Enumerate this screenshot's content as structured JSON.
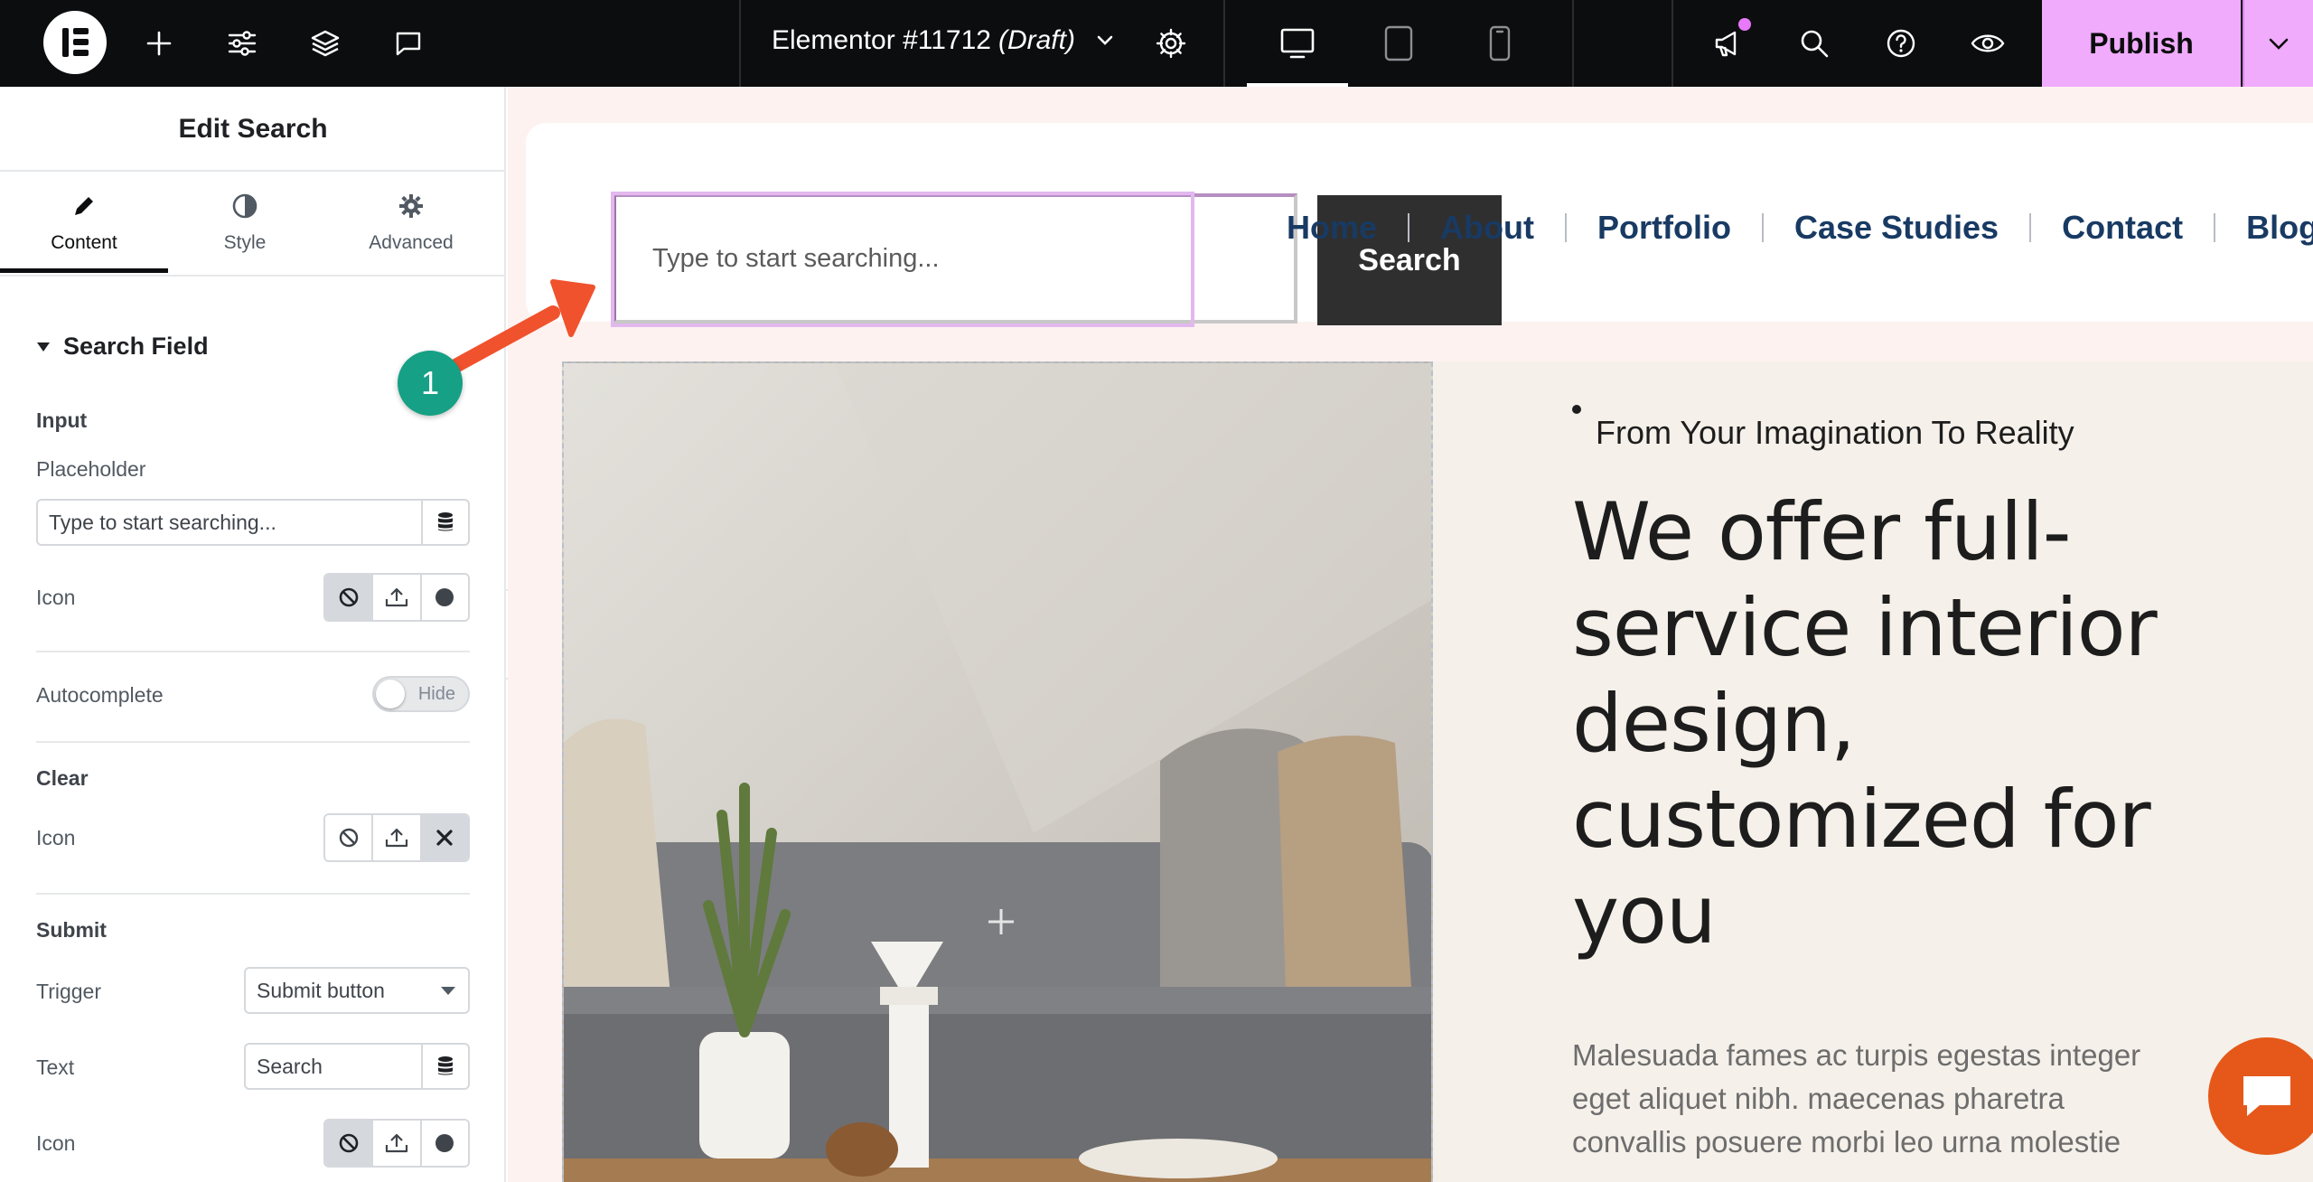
{
  "topbar": {
    "document_name": "Elementor #11712",
    "document_status": "(Draft)",
    "publish_label": "Publish",
    "accent_color": "#f0abfc"
  },
  "panel": {
    "title": "Edit Search",
    "tabs": [
      {
        "label": "Content",
        "icon": "pencil-icon"
      },
      {
        "label": "Style",
        "icon": "contrast-icon"
      },
      {
        "label": "Advanced",
        "icon": "gear-icon"
      }
    ],
    "section_title": "Search Field",
    "input_heading": "Input",
    "placeholder_label": "Placeholder",
    "placeholder_value": "Type to start searching...",
    "icon_label": "Icon",
    "autocomplete_label": "Autocomplete",
    "autocomplete_state": "Hide",
    "clear_heading": "Clear",
    "clear_icon_label": "Icon",
    "submit_heading": "Submit",
    "trigger_label": "Trigger",
    "trigger_value": "Submit button",
    "text_label": "Text",
    "text_value": "Search",
    "submit_icon_label": "Icon"
  },
  "canvas": {
    "search_placeholder": "Type to start searching...",
    "search_button": "Search",
    "nav": [
      "Home",
      "About",
      "Portfolio",
      "Case Studies",
      "Contact",
      "Blog"
    ],
    "tagline": "From Your Imagination To Reality",
    "headline": "We offer full-service interior design, customized for you",
    "body": "Malesuada fames ac turpis egestas integer eget aliquet nibh. maecenas pharetra convallis posuere morbi leo urna molestie"
  },
  "annotation": {
    "step_number": "1",
    "arrow_color": "#f0522d",
    "badge_color": "#16a085"
  }
}
